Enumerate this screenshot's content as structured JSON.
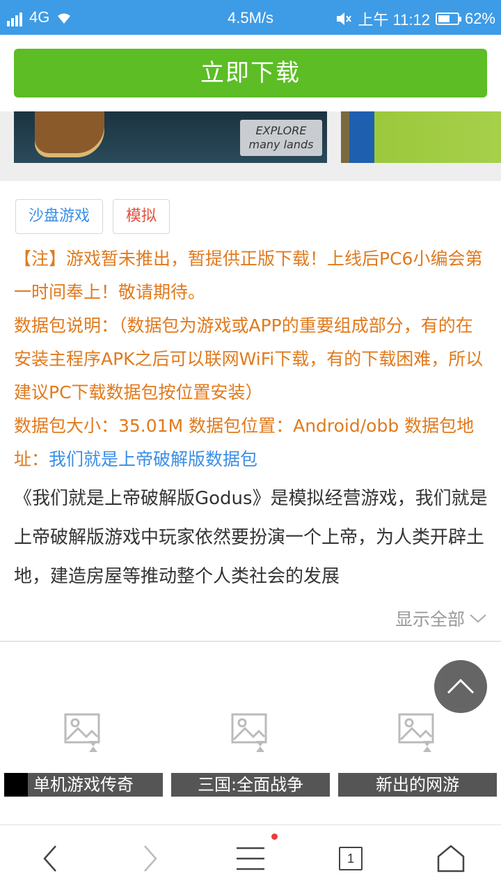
{
  "status": {
    "network": "4G",
    "speed": "4.5M/s",
    "time": "上午 11:12",
    "battery": "62%",
    "battery_level": 0.62
  },
  "download_button": "立即下载",
  "screenshot_text": {
    "line1": "EXPLORE",
    "line2": "many lands"
  },
  "tags": [
    "沙盘游戏",
    "模拟"
  ],
  "notice": {
    "note": "【注】游戏暂未推出，暂提供正版下载！上线后PC6小编会第一时间奉上！敬请期待。",
    "data_desc": "数据包说明：（数据包为游戏或APP的重要组成部分，有的在安装主程序APK之后可以联网WiFi下载，有的下载困难，所以建议PC下载数据包按位置安装）",
    "data_info": "数据包大小：35.01M 数据包位置：Android/obb  数据包地址：",
    "data_link": "我们就是上帝破解版数据包"
  },
  "description": "《我们就是上帝破解版Godus》是模拟经营游戏，我们就是上帝破解版游戏中玩家依然要扮演一个上帝，为人类开辟土地，建造房屋等推动整个人类社会的发展",
  "show_all": "显示全部",
  "recommendations": [
    "单机游戏传奇",
    "三国:全面战争",
    "新出的网游"
  ],
  "bottom_nav": {
    "tab_count": "1",
    "icons": [
      "back-icon",
      "forward-icon",
      "menu-icon",
      "tabs-icon",
      "home-icon"
    ]
  },
  "colors": {
    "status_bar": "#3e9be6",
    "download_green": "#5cbd25",
    "notice_orange": "#e07a1d",
    "link_blue": "#3a8ee6"
  }
}
